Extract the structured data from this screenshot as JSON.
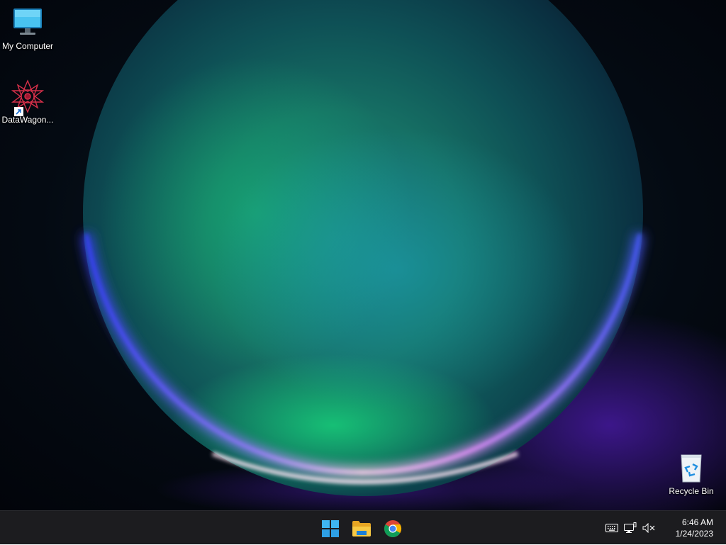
{
  "desktop": {
    "icons": [
      {
        "label": "My Computer",
        "icon": "monitor-icon"
      },
      {
        "label": "DataWagon...",
        "icon": "datawagon-icon"
      },
      {
        "label": "Recycle Bin",
        "icon": "recycle-bin-icon"
      }
    ]
  },
  "taskbar": {
    "apps": [
      {
        "name": "start",
        "icon": "windows-start-icon"
      },
      {
        "name": "file-explorer",
        "icon": "folder-icon"
      },
      {
        "name": "chrome",
        "icon": "chrome-icon"
      }
    ],
    "tray": {
      "icons": [
        "keyboard-icon",
        "network-icon",
        "volume-muted-icon"
      ]
    },
    "clock": {
      "time": "6:46 AM",
      "date": "1/24/2023"
    }
  },
  "colors": {
    "taskbar_bg": "#1c1c1f",
    "accent_blue": "#2ea8e8"
  }
}
